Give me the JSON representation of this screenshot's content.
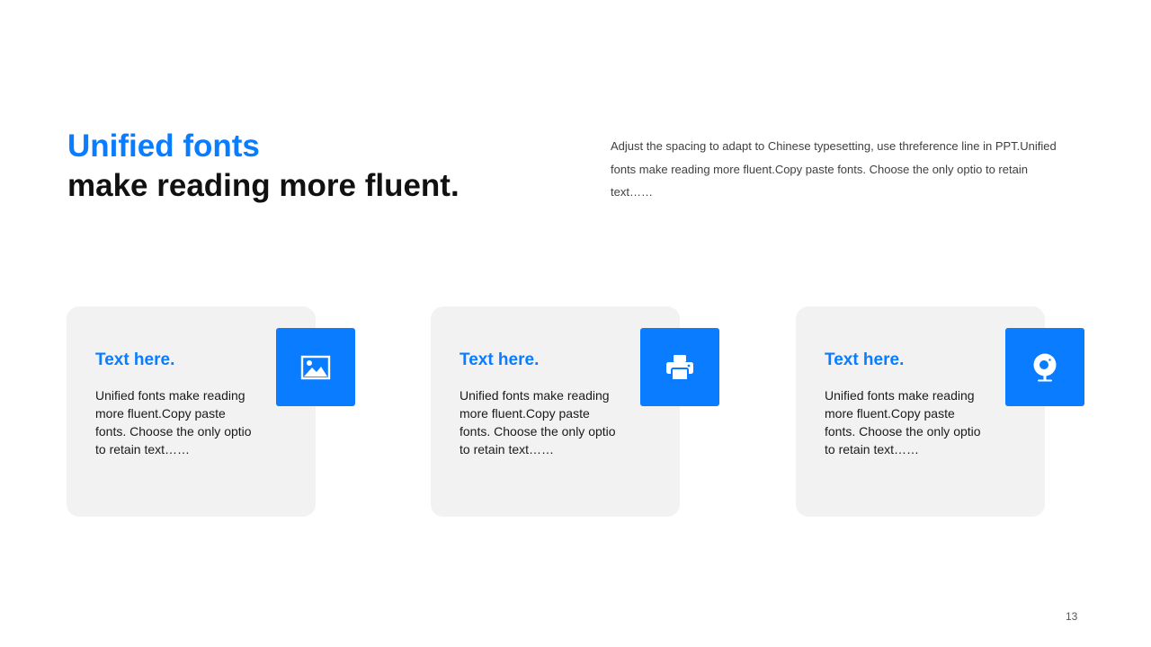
{
  "header": {
    "title_line1": "Unified fonts",
    "title_line2": "make reading more fluent.",
    "intro": "Adjust the spacing to adapt to Chinese typesetting, use threference line in PPT.Unified fonts make reading more fluent.Copy paste fonts. Choose the only optio to retain text……"
  },
  "cards": [
    {
      "title": "Text here.",
      "body": "Unified fonts make reading more fluent.Copy paste fonts. Choose the only optio to retain text……",
      "icon": "image-icon"
    },
    {
      "title": "Text here.",
      "body": "Unified fonts make reading more fluent.Copy paste fonts. Choose the only optio to retain text……",
      "icon": "printer-icon"
    },
    {
      "title": "Text here.",
      "body": "Unified fonts make reading more fluent.Copy paste fonts. Choose the only optio to retain text……",
      "icon": "webcam-icon"
    }
  ],
  "footer": {
    "page_number": "13"
  },
  "colors": {
    "accent": "#0a7cff",
    "card_background": "#f2f2f2",
    "heading": "#111111",
    "body_text": "#404040"
  }
}
